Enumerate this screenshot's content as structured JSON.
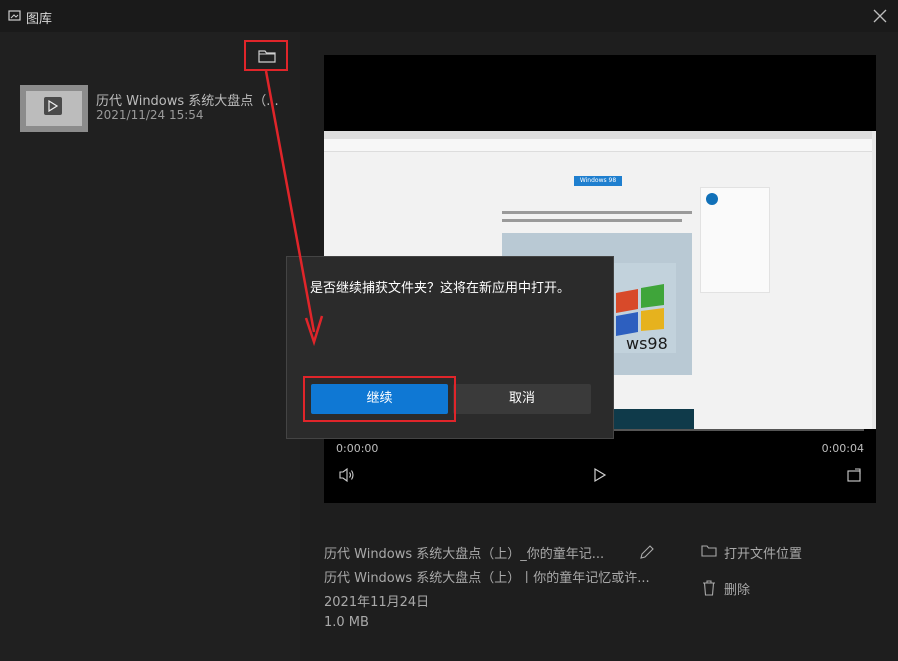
{
  "window": {
    "title": "图库"
  },
  "colors": {
    "accent": "#0f78d4",
    "highlight": "#e0252a",
    "background": "#1e1e1e"
  },
  "gallery": {
    "items": [
      {
        "title": "历代 Windows 系统大盘点（...",
        "date": "2021/11/24 15:54"
      }
    ]
  },
  "video": {
    "badge": "Windows 98",
    "screen_text": "ws98",
    "time_current": "0:00:00",
    "time_total": "0:00:04",
    "progress": 0
  },
  "details": {
    "title": "历代 Windows 系统大盘点（上）_你的童年记...",
    "filename": "历代 Windows 系统大盘点（上）丨你的童年记忆或许...",
    "date": "2021年11月24日",
    "size": "1.0 MB",
    "open_location": "打开文件位置",
    "delete": "删除"
  },
  "dialog": {
    "message": "是否继续捕获文件夹？这将在新应用中打开。",
    "continue": "继续",
    "cancel": "取消"
  }
}
